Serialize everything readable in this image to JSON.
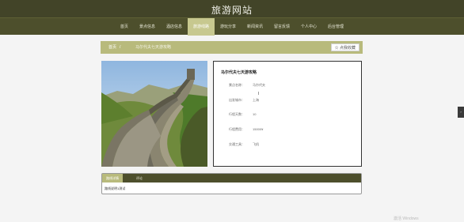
{
  "header": {
    "site_title": "旅游网站"
  },
  "nav": {
    "items": [
      {
        "label": "首页"
      },
      {
        "label": "景点信息"
      },
      {
        "label": "酒店信息"
      },
      {
        "label": "旅游线路"
      },
      {
        "label": "游玩分享"
      },
      {
        "label": "新闻资讯"
      },
      {
        "label": "留言反馈"
      },
      {
        "label": "个人中心"
      },
      {
        "label": "后台管理"
      }
    ],
    "active_index": 3
  },
  "breadcrumb": {
    "home": "首页",
    "separator": "/",
    "current": "马尔代夫七天游攻略"
  },
  "favorite_button": {
    "label": "☆ 点我收藏"
  },
  "detail": {
    "title": "马尔代夫七天游攻略",
    "fields": [
      {
        "label": "景点名称：",
        "value": "马尔代夫"
      },
      {
        "label": "出发城市：",
        "value": "上海"
      },
      {
        "label": "行程天数：",
        "value": "10"
      },
      {
        "label": "行程费用：",
        "value": "15000¥"
      },
      {
        "label": "交通工具：",
        "value": "飞机"
      }
    ]
  },
  "tabs": {
    "items": [
      {
        "label": "路线详情"
      },
      {
        "label": "评论"
      }
    ],
    "active_index": 0,
    "content": "路线说明1测试"
  },
  "watermark": "激活 Windows"
}
